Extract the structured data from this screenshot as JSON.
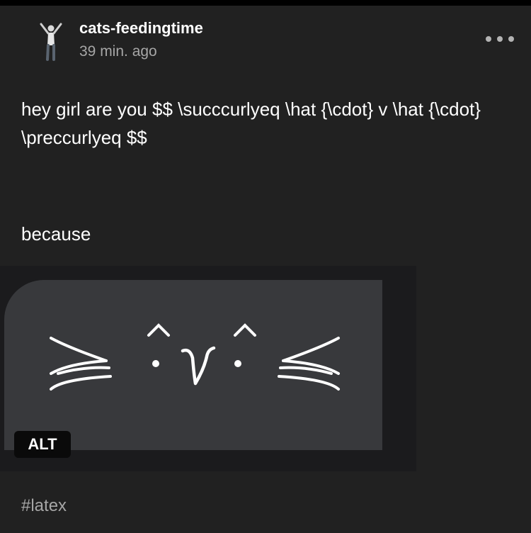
{
  "post": {
    "username": "cats-feedingtime",
    "timestamp": "39 min. ago",
    "body_line": "hey girl are you $$ \\succcurlyeq \\hat {\\cdot} v \\hat {\\cdot} \\preccurlyeq $$",
    "because": "because",
    "image": {
      "alt_badge": "ALT",
      "rendered_text": "≽ ·̂ v ·̂ ≼"
    },
    "tags": [
      "#latex"
    ]
  },
  "icons": {
    "more": "more-horizontal-icon"
  },
  "colors": {
    "background": "#212121",
    "text": "#ffffff",
    "muted": "#a6a6a6",
    "image_bubble": "#38393c"
  }
}
